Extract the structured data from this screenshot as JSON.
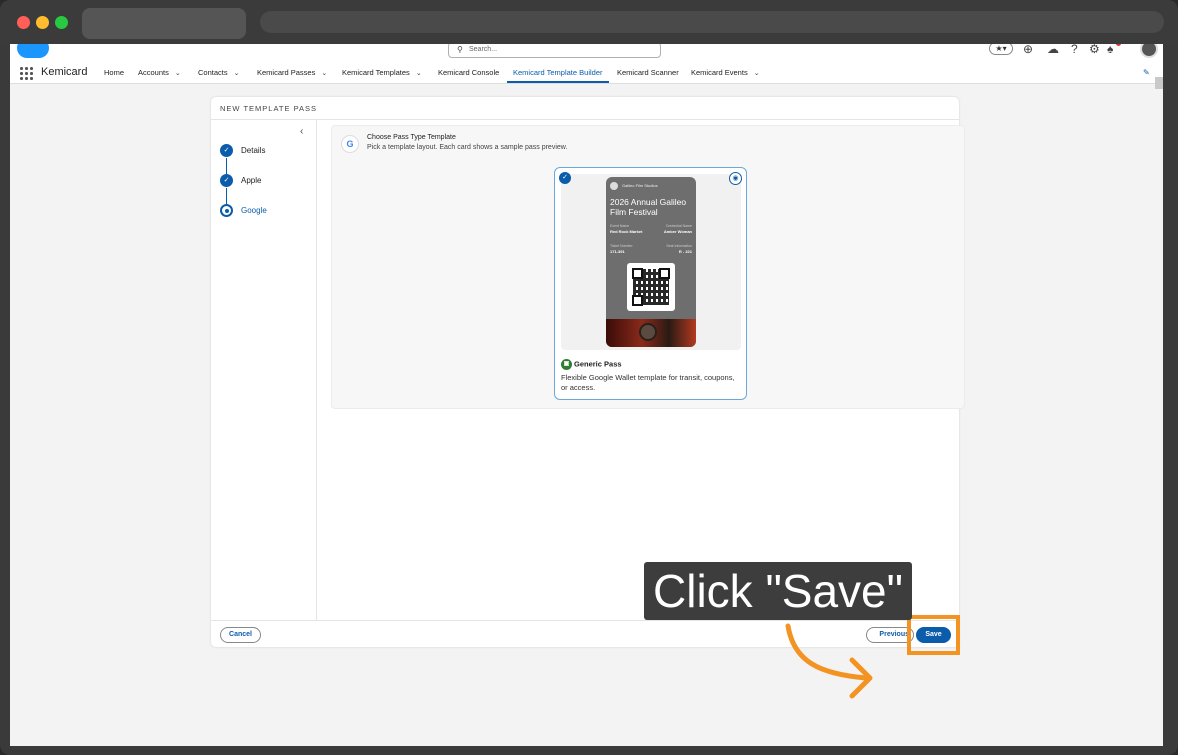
{
  "header": {
    "search_placeholder": "Search..."
  },
  "nav": {
    "app_name": "Kemicard",
    "items": [
      {
        "label": "Home"
      },
      {
        "label": "Accounts"
      },
      {
        "label": "Contacts"
      },
      {
        "label": "Kemicard Passes"
      },
      {
        "label": "Kemicard Templates"
      },
      {
        "label": "Kemicard Console"
      },
      {
        "label": "Kemicard Template Builder"
      },
      {
        "label": "Kemicard Scanner"
      },
      {
        "label": "Kemicard Events"
      }
    ]
  },
  "modal": {
    "title": "NEW TEMPLATE PASS",
    "steps": [
      {
        "label": "Details",
        "state": "complete"
      },
      {
        "label": "Apple",
        "state": "complete"
      },
      {
        "label": "Google",
        "state": "current"
      }
    ],
    "section": {
      "heading": "Choose Pass Type Template",
      "subheading": "Pick a template layout. Each card shows a sample pass preview."
    },
    "template_card": {
      "name": "Generic Pass",
      "description": "Flexible Google Wallet template for transit, coupons, or access.",
      "preview": {
        "issuer": "Galileo Film Studios",
        "title": "2026 Annual Galileo Film Festival",
        "fields": [
          {
            "label": "Event Name",
            "value": "Red Rock Market"
          },
          {
            "label": "Credential Name",
            "value": "Amber Woman"
          },
          {
            "label": "Ticket Number",
            "value": "171-391"
          },
          {
            "label": "Seat Information",
            "value": "R - 221"
          }
        ]
      }
    },
    "buttons": {
      "cancel": "Cancel",
      "previous": "Previous",
      "save": "Save"
    }
  },
  "overlay": {
    "callout_text": "Click \"Save\"",
    "accent_color": "#f39322"
  }
}
